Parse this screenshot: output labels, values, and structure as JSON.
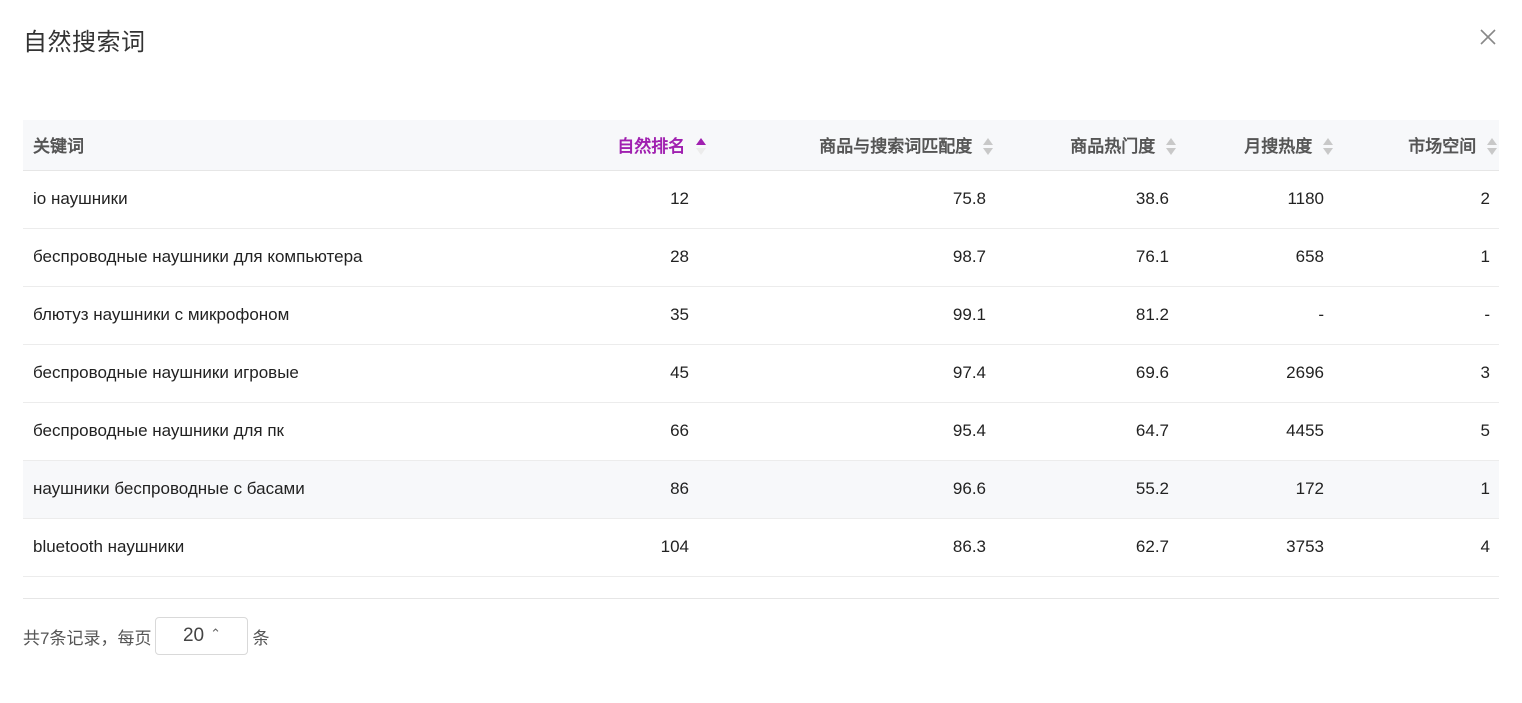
{
  "dialog": {
    "title": "自然搜索词"
  },
  "colors": {
    "accent": "#a020b0",
    "header_bg": "#f7f8fa",
    "border": "#e6e6e6"
  },
  "table": {
    "columns": [
      {
        "label": "关键词",
        "sort": null
      },
      {
        "label": "自然排名",
        "sort": "asc"
      },
      {
        "label": "商品与搜索词匹配度",
        "sort": "none"
      },
      {
        "label": "商品热门度",
        "sort": "none"
      },
      {
        "label": "月搜热度",
        "sort": "none"
      },
      {
        "label": "市场空间",
        "sort": "none"
      }
    ],
    "rows": [
      [
        "io наушники",
        "12",
        "75.8",
        "38.6",
        "1180",
        "2"
      ],
      [
        "беспроводные наушники для компьютера",
        "28",
        "98.7",
        "76.1",
        "658",
        "1"
      ],
      [
        "блютуз наушники с микрофоном",
        "35",
        "99.1",
        "81.2",
        "-",
        "-"
      ],
      [
        "беспроводные наушники игровые",
        "45",
        "97.4",
        "69.6",
        "2696",
        "3"
      ],
      [
        "беспроводные наушники для пк",
        "66",
        "95.4",
        "64.7",
        "4455",
        "5"
      ],
      [
        "наушники беспроводные с басами",
        "86",
        "96.6",
        "55.2",
        "172",
        "1"
      ],
      [
        "bluetooth наушники",
        "104",
        "86.3",
        "62.7",
        "3753",
        "4"
      ]
    ]
  },
  "pagination": {
    "total_text": "共7条记录，每页",
    "page_size": "20",
    "suffix": "条"
  }
}
